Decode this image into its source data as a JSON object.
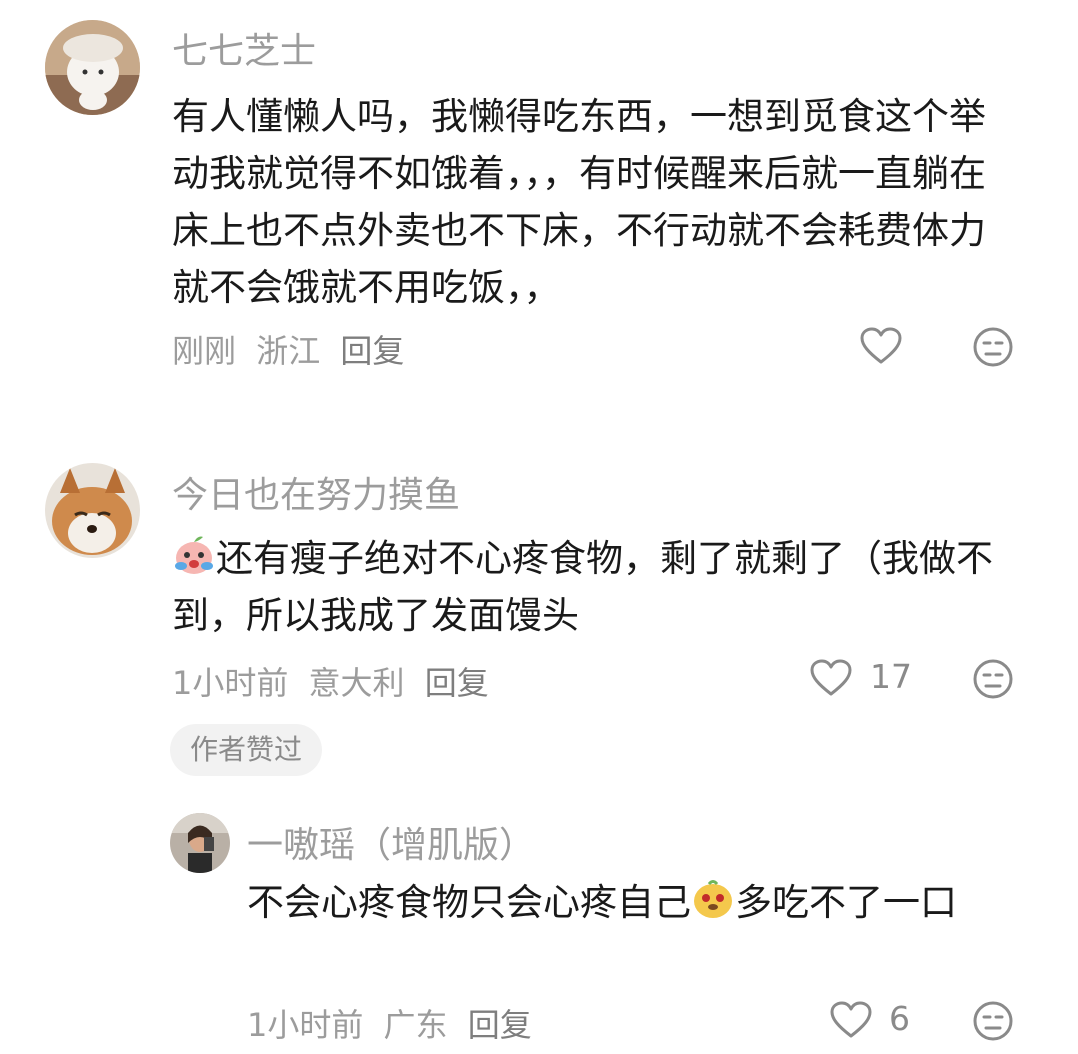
{
  "comments": [
    {
      "username": "七七芝士",
      "text": "有人懂懒人吗，我懒得吃东西，一想到觅食这个举动我就觉得不如饿着，，，有时候醒来后就一直躺在床上也不点外卖也不下床，不行动就不会耗费体力就不会饿就不用吃饭，，",
      "time": "刚刚",
      "location": "浙江",
      "reply_label": "回复",
      "like_icon": "heart-icon",
      "dislike_icon": "neutral-face-icon"
    },
    {
      "username": "今日也在努力摸鱼",
      "text": "还有瘦子绝对不心疼食物，剩了就剩了（我做不到，所以我成了发面馒头",
      "time": "1小时前",
      "location": "意大利",
      "reply_label": "回复",
      "likes": "17",
      "badge": "作者赞过",
      "like_icon": "heart-icon",
      "dislike_icon": "neutral-face-icon"
    },
    {
      "username": "一嗷瑶（增肌版）",
      "text_part1": "不会心疼食物只会心疼自己",
      "text_part2": "多吃不了一口",
      "time": "1小时前",
      "location": "广东",
      "reply_label": "回复",
      "likes": "6",
      "like_icon": "heart-icon",
      "dislike_icon": "neutral-face-icon"
    }
  ],
  "colors": {
    "meta_gray": "#9c9c9c",
    "text": "#1a1a1a",
    "badge_bg": "#f2f2f2"
  }
}
